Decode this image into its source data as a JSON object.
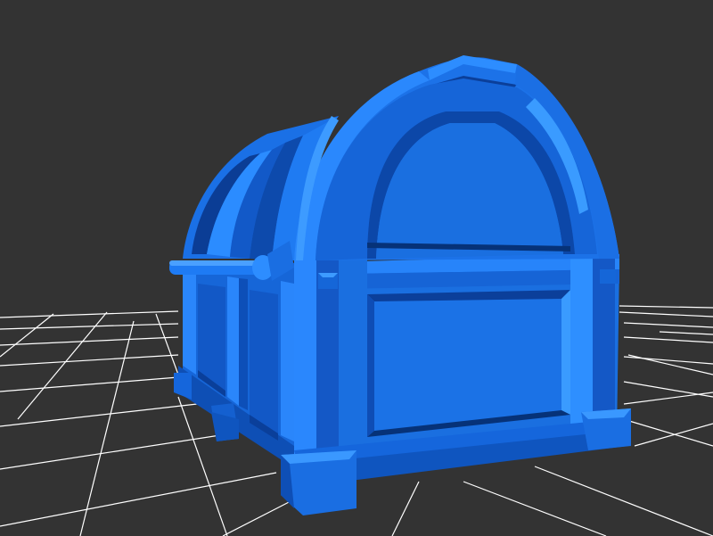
{
  "viewport": {
    "background": "#333333",
    "grid_color": "#ffffff"
  },
  "model": {
    "object": "treasure-chest",
    "colors": {
      "base": "#1a6fe0",
      "light": "#2b8cff",
      "mid": "#1560d0",
      "dark": "#0c47a8",
      "shadow": "#063278"
    }
  }
}
